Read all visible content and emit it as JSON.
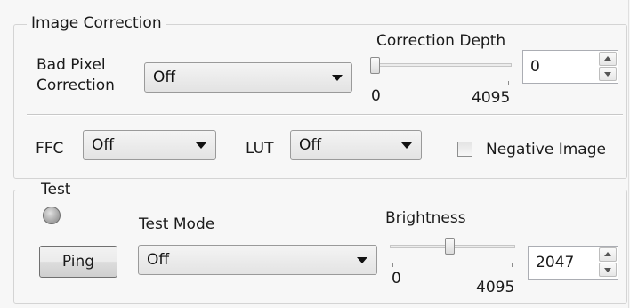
{
  "image_correction": {
    "title": "Image Correction",
    "bad_pixel_label_line1": "Bad Pixel",
    "bad_pixel_label_line2": "Correction",
    "bad_pixel_value": "Off",
    "correction_depth_label": "Correction Depth",
    "correction_depth_min": "0",
    "correction_depth_max": "4095",
    "correction_depth_value": "0",
    "correction_depth_level": 0,
    "ffc_label": "FFC",
    "ffc_value": "Off",
    "lut_label": "LUT",
    "lut_value": "Off",
    "negative_image_label": "Negative Image",
    "negative_image_checked": false
  },
  "test": {
    "title": "Test",
    "ping_label": "Ping",
    "test_mode_label": "Test Mode",
    "test_mode_value": "Off",
    "brightness_label": "Brightness",
    "brightness_min": "0",
    "brightness_max": "4095",
    "brightness_value": "2047",
    "brightness_level": 2047
  }
}
